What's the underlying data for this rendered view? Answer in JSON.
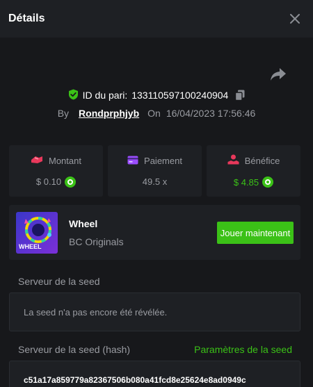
{
  "header": {
    "title": "Détails",
    "close_icon": "close-icon"
  },
  "bet": {
    "id_label": "ID du pari:",
    "id_value": "133110597100240904",
    "by_label": "By",
    "username": "Rondprphjyb",
    "on_label": "On",
    "datetime": "16/04/2023 17:56:46"
  },
  "stats": [
    {
      "label": "Montant",
      "value": "$ 0.10",
      "icon": "wager-icon",
      "color": "#e8385b"
    },
    {
      "label": "Paiement",
      "value": "49.5 x",
      "icon": "card-icon",
      "color": "#9b4dff"
    },
    {
      "label": "Bénéfice",
      "value": "$ 4.85",
      "icon": "profit-icon",
      "color": "#e8385b"
    }
  ],
  "game": {
    "name": "Wheel",
    "provider": "BC Originals",
    "thumb_label": "WHEEL",
    "play_label": "Jouer maintenant"
  },
  "seed": {
    "server_label": "Serveur de la seed",
    "server_value": "La seed n'a pas encore été révélée.",
    "hash_label": "Serveur de la seed (hash)",
    "settings_link": "Paramètres de la seed",
    "hash_value": "c51a17a859779a82367506b080a41fcd8e25624e8ad0949c"
  },
  "colors": {
    "accent": "#3bc117",
    "background": "#17181b",
    "card": "#1e2024"
  }
}
